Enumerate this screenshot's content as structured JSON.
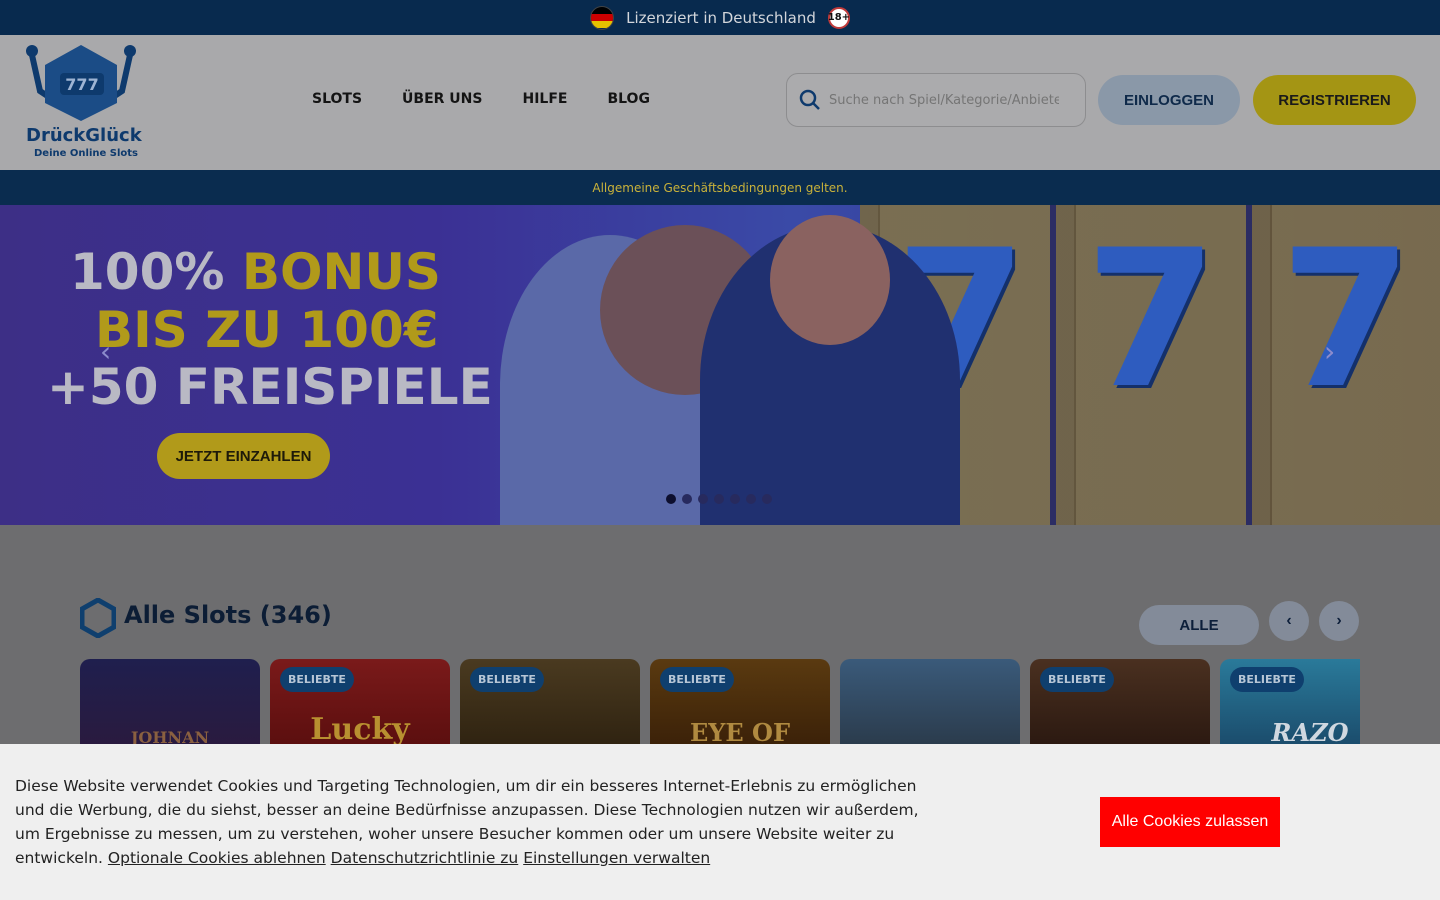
{
  "topbar": {
    "license_text": "Lizenziert in Deutschland",
    "age_badge": "18+",
    "flag_icon": "germany-flag-icon"
  },
  "header": {
    "logo_title": "DrückGlück",
    "logo_subtitle": "Deine Online Slots",
    "logo_reels": "777",
    "nav": [
      "SLOTS",
      "ÜBER UNS",
      "HILFE",
      "BLOG"
    ],
    "search_placeholder": "Suche nach Spiel/Kategorie/Anbieter",
    "login_label": "EINLOGGEN",
    "register_label": "REGISTRIEREN"
  },
  "terms_bar": {
    "text": "Allgemeine Geschäftsbedingungen gelten."
  },
  "hero": {
    "line1_a": "100% ",
    "line1_b": "BONUS",
    "line2": "BIS ZU 100€",
    "line3": "+50 FREISPIELE",
    "cta_label": "JETZT EINZAHLEN",
    "prev_arrow": "‹",
    "next_arrow": "›",
    "slide_count": 7,
    "active_slide": 1
  },
  "slots": {
    "title": "Alle Slots (346)",
    "filter_label": "ALLE",
    "prev_label": "‹",
    "next_label": "›",
    "cards": [
      {
        "badge": "",
        "title": "JOHNAN"
      },
      {
        "badge": "BELIEBTE",
        "title": "Lucky"
      },
      {
        "badge": "BELIEBTE",
        "title": ""
      },
      {
        "badge": "BELIEBTE",
        "title": "EYE OF"
      },
      {
        "badge": "",
        "title": ""
      },
      {
        "badge": "BELIEBTE",
        "title": ""
      },
      {
        "badge": "BELIEBTE",
        "title": "RAZO"
      }
    ]
  },
  "cookie": {
    "text": "Diese Website verwendet Cookies und Targeting Technologien, um dir ein besseres Internet-Erlebnis zu ermöglichen und die Werbung, die du siehst, besser an deine Bedürfnisse anzupassen. Diese Technologien nutzen wir außerdem, um Ergebnisse zu messen, um zu verstehen, woher unsere Besucher kommen oder um unsere Website weiter zu entwickeln.",
    "link_optional": "Optionale Cookies ablehnen",
    "link_privacy": "Datenschutzrichtlinie zu",
    "link_settings": "Einstellungen verwalten",
    "accept_label": "Alle Cookies zulassen"
  },
  "colors": {
    "topbar_bg": "#082a4e",
    "accent_yellow": "#a49514",
    "cookie_button": "#ff0000"
  }
}
